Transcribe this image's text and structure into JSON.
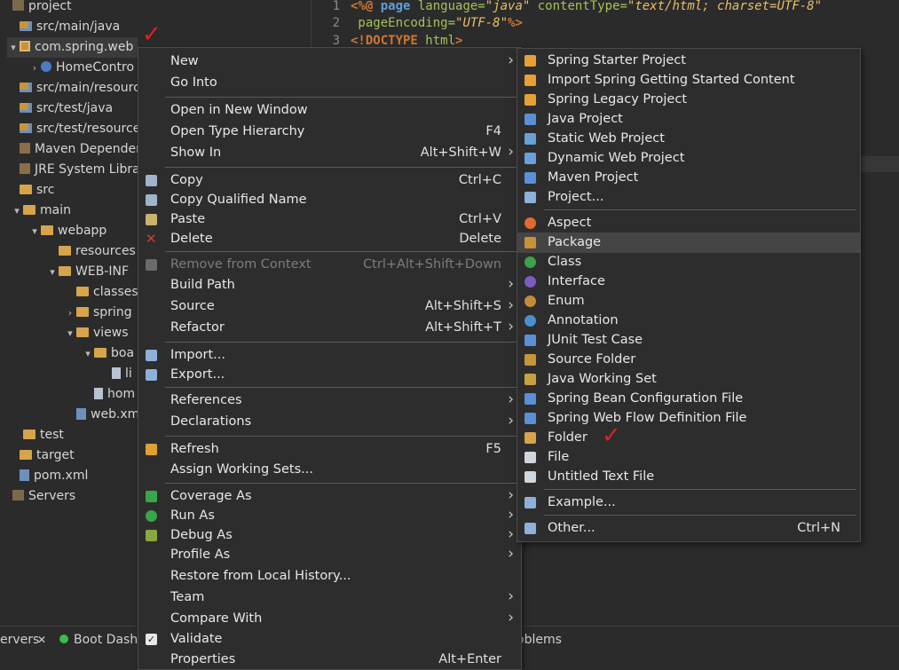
{
  "tree": {
    "rows": [
      {
        "label": "project",
        "icon": "project-icon",
        "twisty": ""
      },
      {
        "label": "src/main/java",
        "icon": "source-folder-icon",
        "twisty": ""
      },
      {
        "label": "com.spring.web",
        "icon": "package-icon",
        "twisty": "▾"
      },
      {
        "label": "HomeContro",
        "icon": "java-class-icon",
        "twisty": "›"
      },
      {
        "label": "src/main/resources",
        "icon": "source-folder-icon",
        "twisty": ""
      },
      {
        "label": "src/test/java",
        "icon": "source-folder-icon",
        "twisty": ""
      },
      {
        "label": "src/test/resources",
        "icon": "source-folder-icon",
        "twisty": ""
      },
      {
        "label": "Maven Dependenc",
        "icon": "library-icon",
        "twisty": ""
      },
      {
        "label": "JRE System Library",
        "icon": "library-icon",
        "twisty": ""
      },
      {
        "label": "src",
        "icon": "folder-icon",
        "twisty": ""
      },
      {
        "label": "main",
        "icon": "folder-icon",
        "twisty": "▾"
      },
      {
        "label": "webapp",
        "icon": "folder-icon",
        "twisty": "▾"
      },
      {
        "label": "resources",
        "icon": "folder-icon",
        "twisty": ""
      },
      {
        "label": "WEB-INF",
        "icon": "folder-icon",
        "twisty": "▾"
      },
      {
        "label": "classes",
        "icon": "folder-icon",
        "twisty": ""
      },
      {
        "label": "spring",
        "icon": "folder-icon",
        "twisty": "›"
      },
      {
        "label": "views",
        "icon": "folder-icon",
        "twisty": "▾"
      },
      {
        "label": "boa",
        "icon": "folder-icon",
        "twisty": "▾"
      },
      {
        "label": "li",
        "icon": "file-icon",
        "twisty": ""
      },
      {
        "label": "hom",
        "icon": "file-icon",
        "twisty": ""
      },
      {
        "label": "web.xm",
        "icon": "xml-file-icon",
        "twisty": ""
      },
      {
        "label": "test",
        "icon": "folder-icon",
        "twisty": ""
      },
      {
        "label": "target",
        "icon": "folder-icon",
        "twisty": ""
      },
      {
        "label": "pom.xml",
        "icon": "xml-file-icon",
        "twisty": ""
      },
      {
        "label": "Servers",
        "icon": "project-icon",
        "twisty": ""
      }
    ]
  },
  "editor": {
    "lines": [
      {
        "num": "1",
        "a": "<%@ ",
        "b": "page",
        "c": " language=",
        "d": "\"java\"",
        "e": " contentType=",
        "f": "\"text/html; charset=UTF-8\""
      },
      {
        "num": "2",
        "a": "    pageEncoding=",
        "b": "\"UTF-8\"",
        "c": "%>"
      },
      {
        "num": "3",
        "a": "<!",
        "b": "DOCTYPE",
        "c": " html",
        "d": ">"
      }
    ]
  },
  "bottom_tabs": {
    "servers": "ervers",
    "close": "✕",
    "boot": "Boot Dash",
    "problems": "oblems"
  },
  "context_menu": {
    "items": [
      {
        "label": "New",
        "shortcut": "",
        "submenu": true,
        "icon": ""
      },
      {
        "label": "Go Into",
        "shortcut": "",
        "submenu": false,
        "icon": ""
      },
      {
        "sep": true
      },
      {
        "label": "Open in New Window",
        "shortcut": "",
        "submenu": false,
        "icon": ""
      },
      {
        "label": "Open Type Hierarchy",
        "shortcut": "F4",
        "submenu": false,
        "icon": ""
      },
      {
        "label": "Show In",
        "shortcut": "Alt+Shift+W",
        "submenu": true,
        "icon": ""
      },
      {
        "sep": true
      },
      {
        "label": "Copy",
        "shortcut": "Ctrl+C",
        "submenu": false,
        "icon": "copy-icon"
      },
      {
        "label": "Copy Qualified Name",
        "shortcut": "",
        "submenu": false,
        "icon": "copy-qualified-icon"
      },
      {
        "label": "Paste",
        "shortcut": "Ctrl+V",
        "submenu": false,
        "icon": "paste-icon"
      },
      {
        "label": "Delete",
        "shortcut": "Delete",
        "submenu": false,
        "icon": "delete-icon"
      },
      {
        "sep": true
      },
      {
        "label": "Remove from Context",
        "shortcut": "Ctrl+Alt+Shift+Down",
        "submenu": false,
        "icon": "remove-context-icon",
        "disabled": true
      },
      {
        "label": "Build Path",
        "shortcut": "",
        "submenu": true,
        "icon": ""
      },
      {
        "label": "Source",
        "shortcut": "Alt+Shift+S",
        "submenu": true,
        "icon": ""
      },
      {
        "label": "Refactor",
        "shortcut": "Alt+Shift+T",
        "submenu": true,
        "icon": ""
      },
      {
        "sep": true
      },
      {
        "label": "Import...",
        "shortcut": "",
        "submenu": false,
        "icon": "import-icon"
      },
      {
        "label": "Export...",
        "shortcut": "",
        "submenu": false,
        "icon": "export-icon"
      },
      {
        "sep": true
      },
      {
        "label": "References",
        "shortcut": "",
        "submenu": true,
        "icon": ""
      },
      {
        "label": "Declarations",
        "shortcut": "",
        "submenu": true,
        "icon": ""
      },
      {
        "sep": true
      },
      {
        "label": "Refresh",
        "shortcut": "F5",
        "submenu": false,
        "icon": "refresh-icon"
      },
      {
        "label": "Assign Working Sets...",
        "shortcut": "",
        "submenu": false,
        "icon": ""
      },
      {
        "sep": true
      },
      {
        "label": "Coverage As",
        "shortcut": "",
        "submenu": true,
        "icon": "coverage-icon"
      },
      {
        "label": "Run As",
        "shortcut": "",
        "submenu": true,
        "icon": "run-icon"
      },
      {
        "label": "Debug As",
        "shortcut": "",
        "submenu": true,
        "icon": "debug-icon"
      },
      {
        "label": "Profile As",
        "shortcut": "",
        "submenu": true,
        "icon": ""
      },
      {
        "label": "Restore from Local History...",
        "shortcut": "",
        "submenu": false,
        "icon": ""
      },
      {
        "label": "Team",
        "shortcut": "",
        "submenu": true,
        "icon": ""
      },
      {
        "label": "Compare With",
        "shortcut": "",
        "submenu": true,
        "icon": ""
      },
      {
        "label": "Validate",
        "shortcut": "",
        "submenu": false,
        "icon": "validate-icon"
      },
      {
        "label": "Properties",
        "shortcut": "Alt+Enter",
        "submenu": false,
        "icon": ""
      }
    ]
  },
  "new_submenu": {
    "items": [
      {
        "label": "Spring Starter Project",
        "shortcut": "",
        "icon": "spring-starter-icon"
      },
      {
        "label": "Import Spring Getting Started Content",
        "shortcut": "",
        "icon": "spring-import-icon"
      },
      {
        "label": "Spring Legacy Project",
        "shortcut": "",
        "icon": "spring-legacy-icon"
      },
      {
        "label": "Java Project",
        "shortcut": "",
        "icon": "java-project-icon"
      },
      {
        "label": "Static Web Project",
        "shortcut": "",
        "icon": "static-web-icon"
      },
      {
        "label": "Dynamic Web Project",
        "shortcut": "",
        "icon": "dynamic-web-icon"
      },
      {
        "label": "Maven Project",
        "shortcut": "",
        "icon": "maven-icon"
      },
      {
        "label": "Project...",
        "shortcut": "",
        "icon": "project-wizard-icon"
      },
      {
        "sep": true
      },
      {
        "label": "Aspect",
        "shortcut": "",
        "icon": "aspect-icon"
      },
      {
        "label": "Package",
        "shortcut": "",
        "icon": "package-icon",
        "highlighted": true
      },
      {
        "label": "Class",
        "shortcut": "",
        "icon": "class-icon"
      },
      {
        "label": "Interface",
        "shortcut": "",
        "icon": "interface-icon"
      },
      {
        "label": "Enum",
        "shortcut": "",
        "icon": "enum-icon"
      },
      {
        "label": "Annotation",
        "shortcut": "",
        "icon": "annotation-icon"
      },
      {
        "label": "JUnit Test Case",
        "shortcut": "",
        "icon": "junit-icon"
      },
      {
        "label": "Source Folder",
        "shortcut": "",
        "icon": "source-folder-icon"
      },
      {
        "label": "Java Working Set",
        "shortcut": "",
        "icon": "working-set-icon"
      },
      {
        "label": "Spring Bean Configuration File",
        "shortcut": "",
        "icon": "spring-bean-icon"
      },
      {
        "label": "Spring Web Flow Definition File",
        "shortcut": "",
        "icon": "spring-webflow-icon"
      },
      {
        "label": "Folder",
        "shortcut": "",
        "icon": "folder-icon"
      },
      {
        "label": "File",
        "shortcut": "",
        "icon": "file-icon"
      },
      {
        "label": "Untitled Text File",
        "shortcut": "",
        "icon": "text-file-icon"
      },
      {
        "sep": true
      },
      {
        "label": "Example...",
        "shortcut": "",
        "icon": "example-icon"
      },
      {
        "sep": true
      },
      {
        "label": "Other...",
        "shortcut": "Ctrl+N",
        "icon": "other-icon"
      }
    ]
  },
  "colors": {
    "background": "#2b2b2b",
    "menu_bg": "#2d2d2d",
    "highlight": "#454545",
    "annotation_red": "#e02020"
  }
}
